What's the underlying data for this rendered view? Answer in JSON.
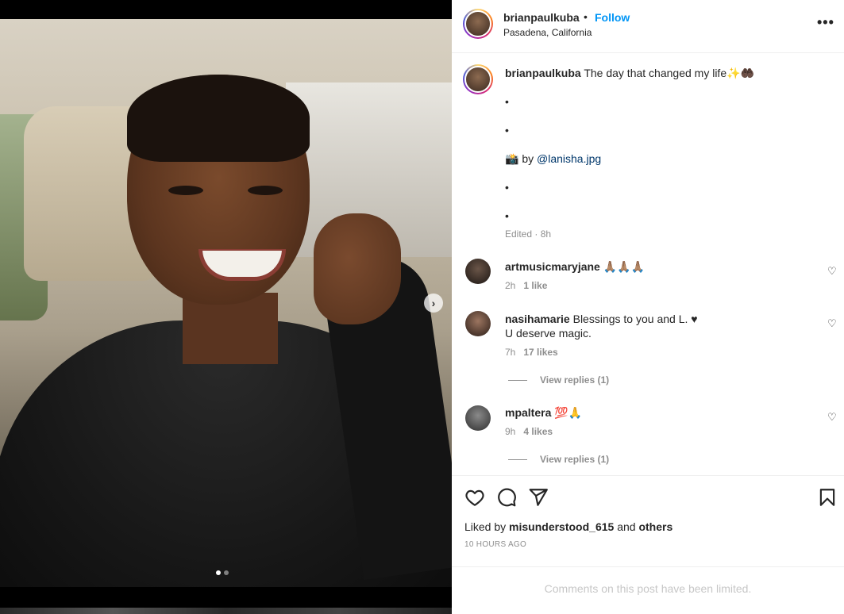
{
  "post": {
    "username": "brianpaulkuba",
    "separator": "•",
    "follow_label": "Follow",
    "location": "Pasadena, California",
    "more_label": "•••"
  },
  "caption": {
    "username": "brianpaulkuba",
    "text": "The day that changed my life✨🤲🏿",
    "bullet": "•",
    "photo_credit_prefix": "📸 by",
    "photo_credit_mention": "@lanisha.jpg",
    "edited": "Edited · 8h"
  },
  "comments": [
    {
      "username": "artmusicmaryjane",
      "text": "🙏🏽🙏🏽🙏🏽",
      "time": "2h",
      "likes": "1 like"
    },
    {
      "username": "nasihamarie",
      "text": "Blessings to you and L. ♥",
      "text2": "U deserve magic.",
      "time": "7h",
      "likes": "17 likes",
      "replies": "View replies (1)"
    },
    {
      "username": "mpaltera",
      "text": "💯🙏",
      "time": "9h",
      "likes": "4 likes",
      "replies": "View replies (1)"
    }
  ],
  "actions": {
    "liked_prefix": "Liked by",
    "liked_user": "misunderstood_615",
    "liked_and": "and",
    "liked_others": "others",
    "time_ago": "10 HOURS AGO"
  },
  "footer": {
    "limited": "Comments on this post have been limited."
  },
  "media": {
    "next_arrow": "›",
    "slide_count": 2,
    "active_slide": 1
  },
  "colors": {
    "follow": "#0095f6",
    "mention": "#00376b",
    "meta": "#8e8e8e"
  }
}
